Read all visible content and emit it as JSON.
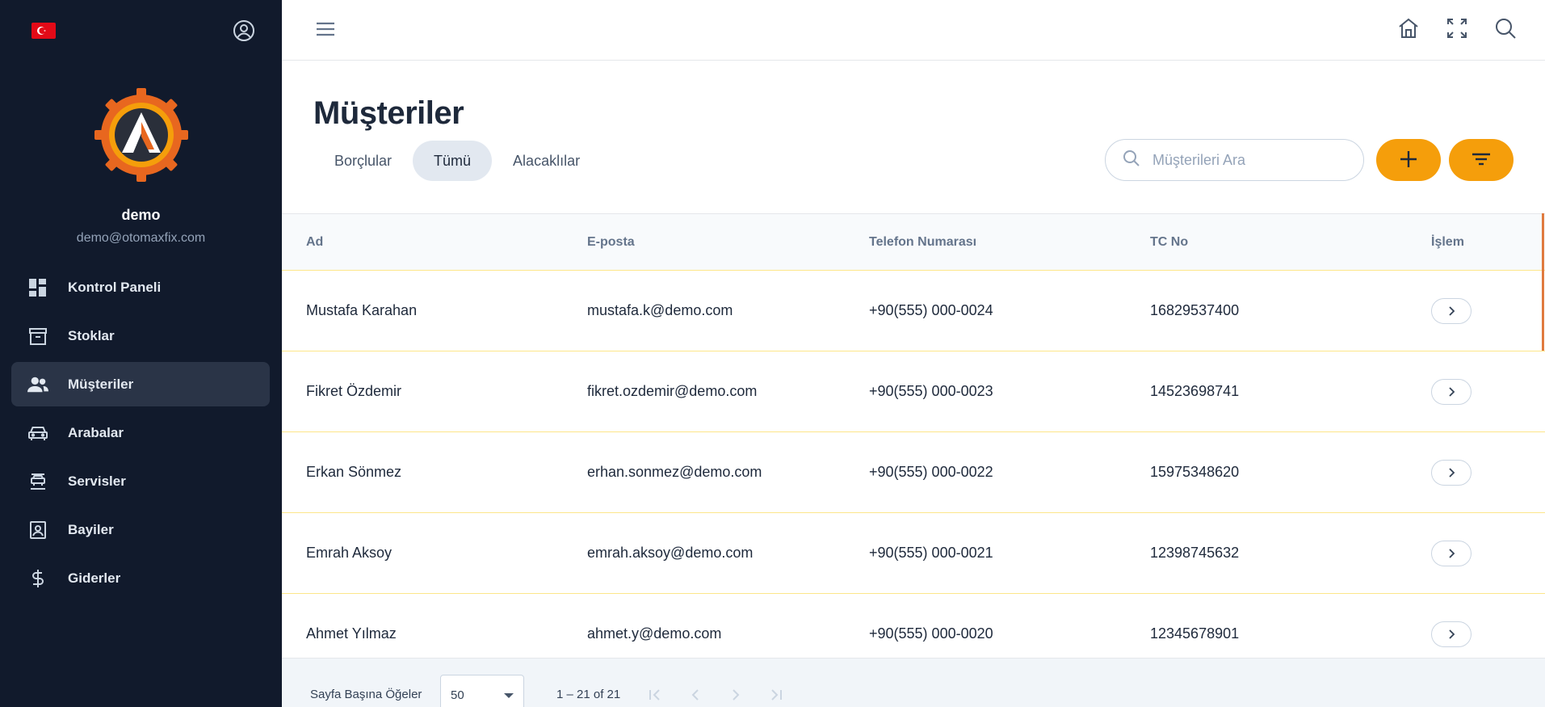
{
  "sidebar": {
    "user_name": "demo",
    "user_email": "demo@otomaxfix.com",
    "items": [
      {
        "label": "Kontrol Paneli",
        "icon": "dashboard-icon"
      },
      {
        "label": "Stoklar",
        "icon": "archive-icon"
      },
      {
        "label": "Müşteriler",
        "icon": "people-icon",
        "active": true
      },
      {
        "label": "Arabalar",
        "icon": "car-icon"
      },
      {
        "label": "Servisler",
        "icon": "service-icon"
      },
      {
        "label": "Bayiler",
        "icon": "dealer-icon"
      },
      {
        "label": "Giderler",
        "icon": "dollar-icon"
      }
    ]
  },
  "header": {
    "title": "Müşteriler",
    "tabs": [
      "Borçlular",
      "Tümü",
      "Alacaklılar"
    ],
    "active_tab": "Tümü",
    "search_placeholder": "Müşterileri Ara"
  },
  "table": {
    "columns": [
      "Ad",
      "E-posta",
      "Telefon Numarası",
      "TC No",
      "İşlem"
    ],
    "rows": [
      {
        "name": "Mustafa Karahan",
        "email": "mustafa.k@demo.com",
        "phone": "+90(555) 000-0024",
        "tc": "16829537400"
      },
      {
        "name": "Fikret Özdemir",
        "email": "fikret.ozdemir@demo.com",
        "phone": "+90(555) 000-0023",
        "tc": "14523698741"
      },
      {
        "name": "Erkan Sönmez",
        "email": "erhan.sonmez@demo.com",
        "phone": "+90(555) 000-0022",
        "tc": "15975348620"
      },
      {
        "name": "Emrah Aksoy",
        "email": "emrah.aksoy@demo.com",
        "phone": "+90(555) 000-0021",
        "tc": "12398745632"
      },
      {
        "name": "Ahmet Yılmaz",
        "email": "ahmet.y@demo.com",
        "phone": "+90(555) 000-0020",
        "tc": "12345678901"
      }
    ]
  },
  "footer": {
    "per_page_label": "Sayfa Başına Öğeler",
    "per_page_value": "50",
    "range": "1 – 21 of 21"
  },
  "colors": {
    "sidebar_bg": "#111a2c",
    "accent": "#f59e0b",
    "row_divider": "#fde68a"
  }
}
